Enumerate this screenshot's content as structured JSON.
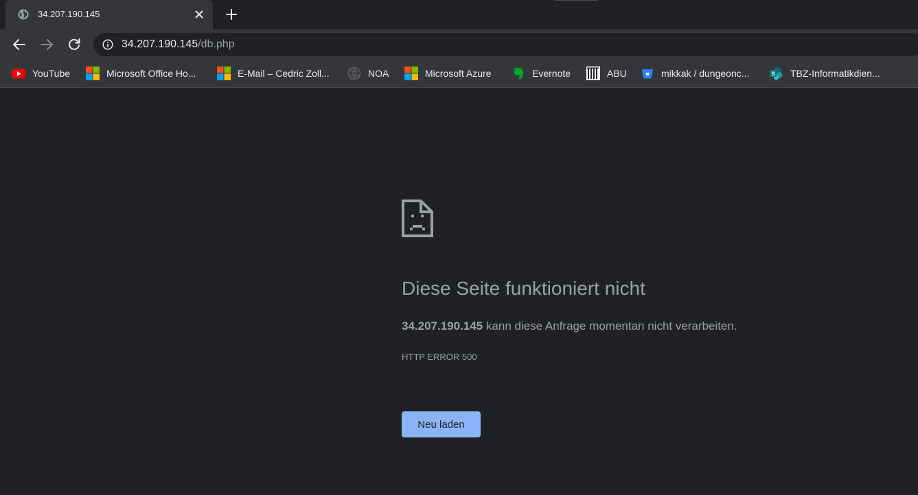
{
  "browser": {
    "tab": {
      "title": "34.207.190.145"
    },
    "omnibox": {
      "host": "34.207.190.145",
      "path": "/db.php"
    }
  },
  "bookmarks": [
    {
      "label": "YouTube",
      "icon": "youtube-icon"
    },
    {
      "label": "Microsoft Office Ho...",
      "icon": "microsoft-icon"
    },
    {
      "label": "E-Mail – Cedric Zoll...",
      "icon": "microsoft-icon"
    },
    {
      "label": "NOA",
      "icon": "globe-icon"
    },
    {
      "label": "Microsoft Azure",
      "icon": "microsoft-icon"
    },
    {
      "label": "Evernote",
      "icon": "evernote-icon"
    },
    {
      "label": "ABU",
      "icon": "library-icon"
    },
    {
      "label": "mikkak / dungeonc...",
      "icon": "bitbucket-icon"
    },
    {
      "label": "TBZ-Informatikdien...",
      "icon": "sharepoint-icon"
    }
  ],
  "error": {
    "heading": "Diese Seite funktioniert nicht",
    "host": "34.207.190.145",
    "message": "kann diese Anfrage momentan nicht verarbeiten.",
    "code": "HTTP ERROR 500",
    "reload_label": "Neu laden"
  },
  "colors": {
    "background": "#202124",
    "toolbar": "#35363a",
    "text_secondary": "#9aa0a6",
    "button": "#8ab4f8"
  }
}
